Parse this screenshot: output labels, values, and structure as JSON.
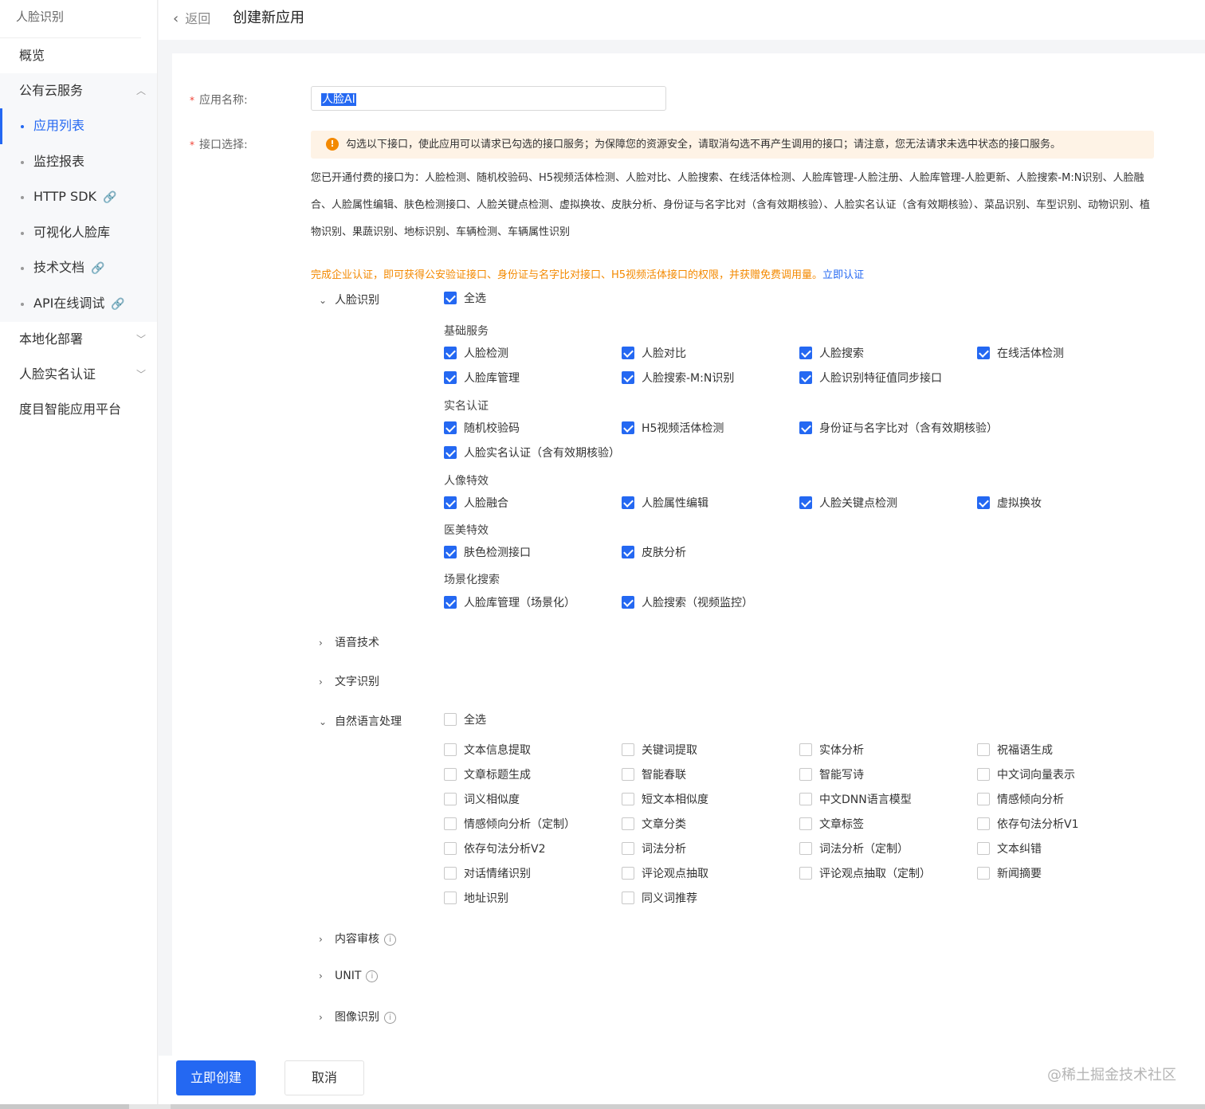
{
  "sidebar": {
    "title": "人脸识别",
    "items": [
      {
        "label": "概览"
      },
      {
        "label": "公有云服务",
        "chevron": "⌃"
      },
      {
        "label": "本地化部署",
        "chevron": "⌄"
      },
      {
        "label": "人脸实名认证",
        "chevron": "⌄"
      },
      {
        "label": "度目智能应用平台"
      }
    ],
    "subitems": [
      {
        "label": "应用列表",
        "active": true
      },
      {
        "label": "监控报表"
      },
      {
        "label": "HTTP SDK",
        "link": true
      },
      {
        "label": "可视化人脸库"
      },
      {
        "label": "技术文档",
        "link": true
      },
      {
        "label": "API在线调试",
        "link": true
      }
    ]
  },
  "header": {
    "back_label": "返回",
    "title": "创建新应用"
  },
  "form": {
    "name_label": "应用名称:",
    "name_value": "人脸AI",
    "api_label": "接口选择:",
    "notice": "勾选以下接口，使此应用可以请求已勾选的接口服务；为保障您的资源安全，请取消勾选不再产生调用的接口；请注意，您无法请求未选中状态的接口服务。",
    "paid_text": "您已开通付费的接口为：人脸检测、随机校验码、H5视频活体检测、人脸对比、人脸搜索、在线活体检测、人脸库管理-人脸注册、人脸库管理-人脸更新、人脸搜索-M:N识别、人脸融合、人脸属性编辑、肤色检测接口、人脸关键点检测、虚拟换妆、皮肤分析、身份证与名字比对（含有效期核验）、人脸实名认证（含有效期核验）、菜品识别、车型识别、动物识别、植物识别、果蔬识别、地标识别、车辆检测、车辆属性识别",
    "promo_text": "完成企业认证，即可获得公安验证接口、身份证与名字比对接口、H5视频活体接口的权限，并获赠免费调用量。",
    "promo_link": "立即认证"
  },
  "groups": {
    "face": {
      "label": "人脸识别",
      "select_all": "全选",
      "sections": [
        {
          "title": "基础服务",
          "items": [
            "人脸检测",
            "人脸对比",
            "人脸搜索",
            "在线活体检测",
            "人脸库管理",
            "人脸搜索-M:N识别",
            "人脸识别特征值同步接口"
          ]
        },
        {
          "title": "实名认证",
          "items": [
            "随机校验码",
            "H5视频活体检测",
            "身份证与名字比对（含有效期核验）",
            "人脸实名认证（含有效期核验）"
          ]
        },
        {
          "title": "人像特效",
          "items": [
            "人脸融合",
            "人脸属性编辑",
            "人脸关键点检测",
            "虚拟换妆"
          ]
        },
        {
          "title": "医美特效",
          "items": [
            "肤色检测接口",
            "皮肤分析"
          ]
        },
        {
          "title": "场景化搜索",
          "items": [
            "人脸库管理（场景化）",
            "人脸搜索（视频监控）"
          ]
        }
      ]
    },
    "voice": {
      "label": "语音技术"
    },
    "ocr": {
      "label": "文字识别"
    },
    "nlp": {
      "label": "自然语言处理",
      "select_all": "全选",
      "items": [
        "文本信息提取",
        "关键词提取",
        "实体分析",
        "祝福语生成",
        "文章标题生成",
        "智能春联",
        "智能写诗",
        "中文词向量表示",
        "词义相似度",
        "短文本相似度",
        "中文DNN语言模型",
        "情感倾向分析",
        "情感倾向分析（定制）",
        "文章分类",
        "文章标签",
        "依存句法分析V1",
        "依存句法分析V2",
        "词法分析",
        "词法分析（定制）",
        "文本纠错",
        "对话情绪识别",
        "评论观点抽取",
        "评论观点抽取（定制）",
        "新闻摘要",
        "地址识别",
        "同义词推荐"
      ]
    },
    "content_review": {
      "label": "内容审核"
    },
    "unit": {
      "label": "UNIT"
    },
    "image": {
      "label": "图像识别"
    }
  },
  "footer": {
    "create_label": "立即创建",
    "cancel_label": "取消",
    "watermark": "@稀土掘金技术社区"
  },
  "colors": {
    "accent": "#2468f2",
    "warning": "#f38900",
    "notice_bg": "#fef3e6",
    "required": "#f04134"
  }
}
